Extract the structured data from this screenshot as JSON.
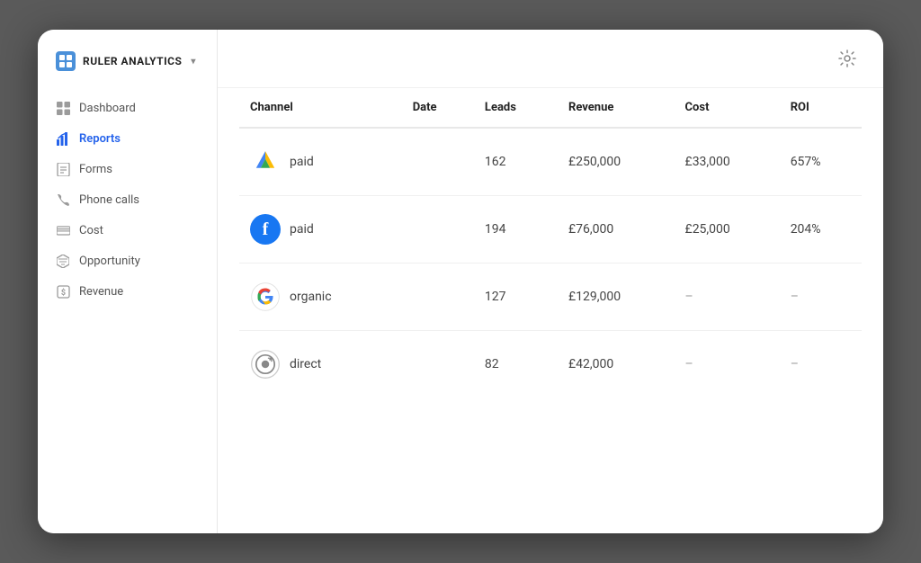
{
  "brand": {
    "name": "RULER ANALYTICS",
    "chevron": "▾"
  },
  "nav": {
    "items": [
      {
        "id": "dashboard",
        "label": "Dashboard",
        "icon": "grid"
      },
      {
        "id": "reports",
        "label": "Reports",
        "icon": "chart",
        "active": true
      },
      {
        "id": "forms",
        "label": "Forms",
        "icon": "form"
      },
      {
        "id": "phone-calls",
        "label": "Phone calls",
        "icon": "phone"
      },
      {
        "id": "cost",
        "label": "Cost",
        "icon": "cost"
      },
      {
        "id": "opportunity",
        "label": "Opportunity",
        "icon": "funnel"
      },
      {
        "id": "revenue",
        "label": "Revenue",
        "icon": "revenue"
      }
    ]
  },
  "table": {
    "columns": [
      "Channel",
      "Date",
      "Leads",
      "Revenue",
      "Cost",
      "ROI"
    ],
    "rows": [
      {
        "channel": "Google Ads",
        "channel_type": "google-ads",
        "type": "paid",
        "leads": "162",
        "revenue": "£250,000",
        "cost": "£33,000",
        "roi": "657%"
      },
      {
        "channel": "Facebook",
        "channel_type": "facebook",
        "type": "paid",
        "leads": "194",
        "revenue": "£76,000",
        "cost": "£25,000",
        "roi": "204%"
      },
      {
        "channel": "Google",
        "channel_type": "google",
        "type": "organic",
        "leads": "127",
        "revenue": "£129,000",
        "cost": "–",
        "roi": "–"
      },
      {
        "channel": "Direct",
        "channel_type": "direct",
        "type": "direct",
        "leads": "82",
        "revenue": "£42,000",
        "cost": "–",
        "roi": "–"
      }
    ]
  },
  "gear_label": "⚙"
}
